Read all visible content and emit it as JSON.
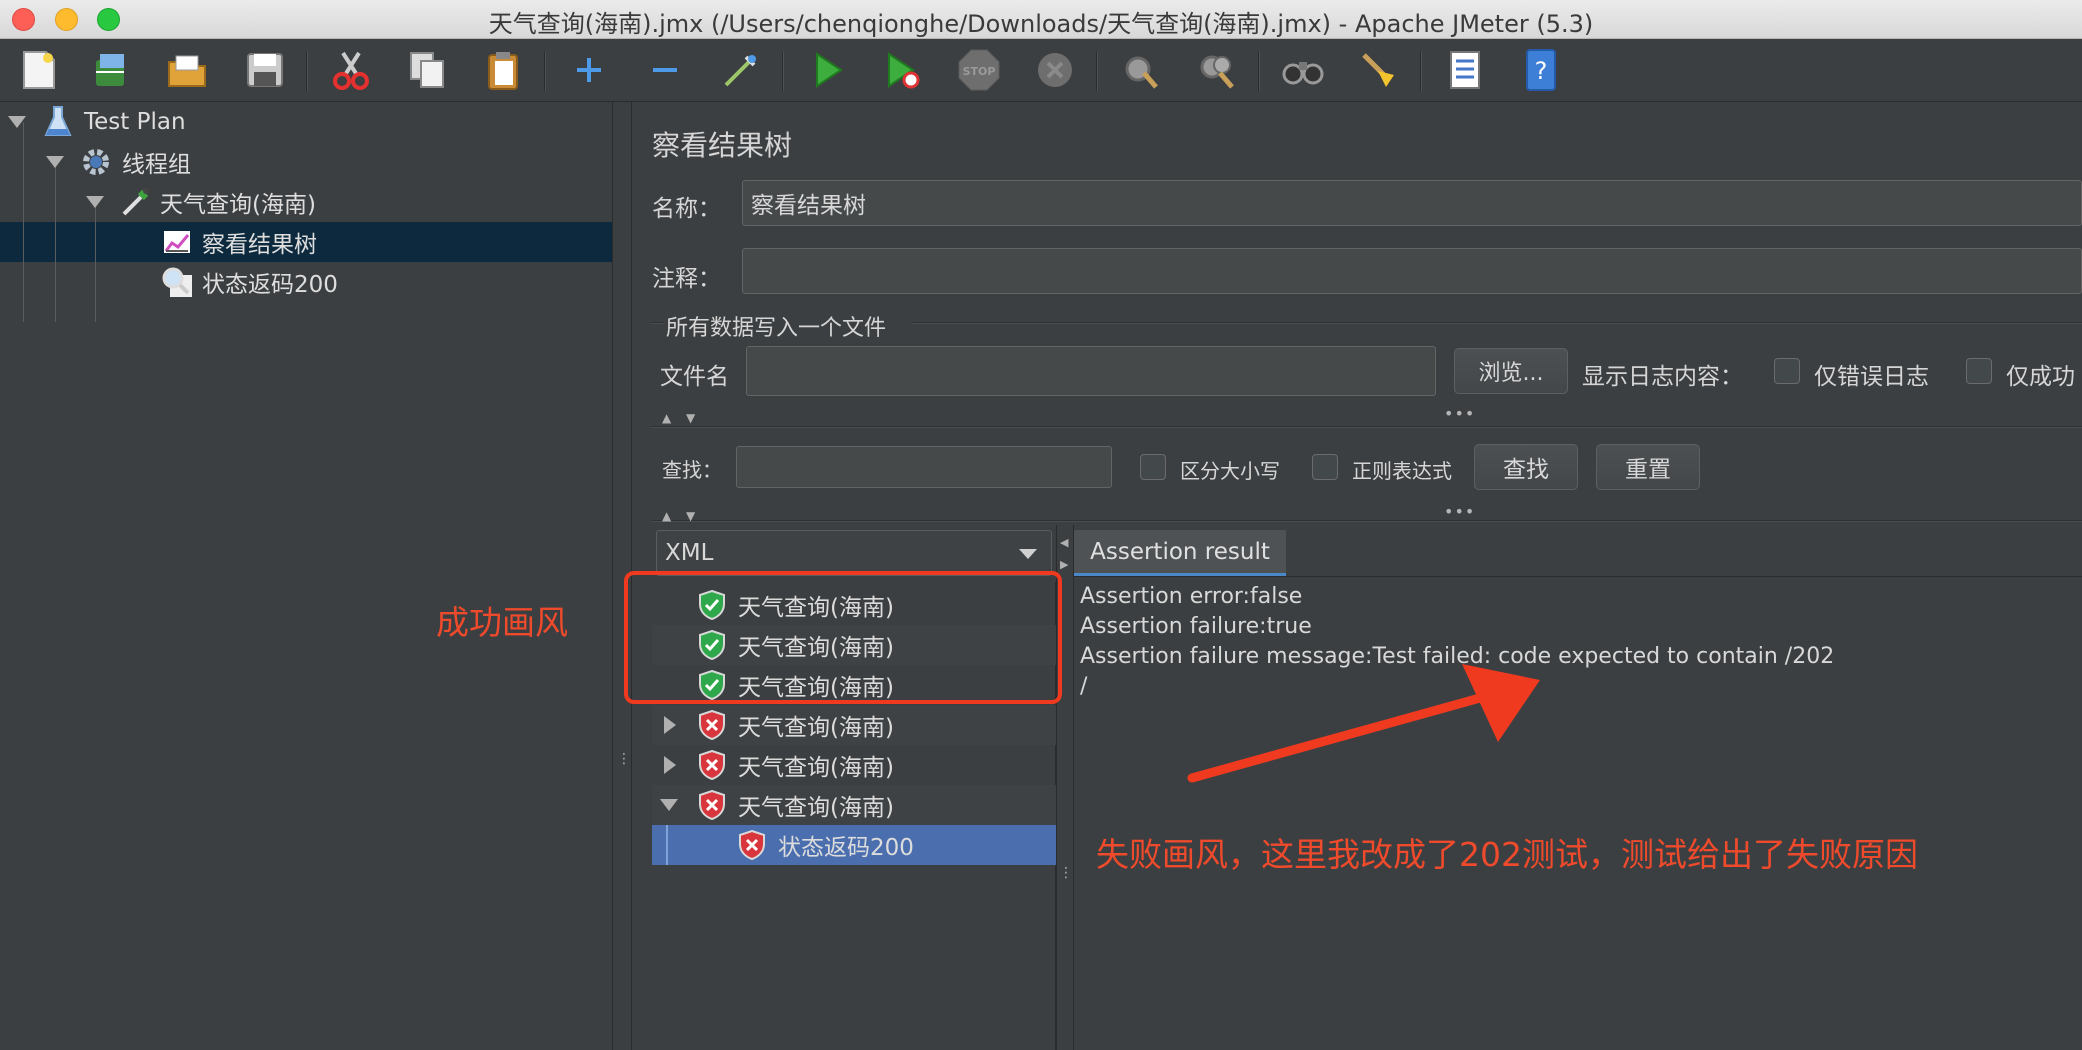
{
  "window": {
    "title": "天气查询(海南).jmx (/Users/chenqionghe/Downloads/天气查询(海南).jmx) - Apache JMeter (5.3)"
  },
  "toolbar": {
    "icons": [
      "new-file-icon",
      "templates-icon",
      "open-icon",
      "save-icon",
      "cut-icon",
      "copy-icon",
      "paste-icon",
      "expand-icon",
      "collapse-icon",
      "toggle-icon",
      "start-icon",
      "start-no-pause-icon",
      "stop-icon",
      "shutdown-icon",
      "clear-icon",
      "clear-all-icon",
      "search-icon",
      "reset-search-icon",
      "function-helper-icon",
      "help-icon"
    ]
  },
  "tree": {
    "items": [
      {
        "label": "Test Plan",
        "icon": "flask-icon"
      },
      {
        "label": "线程组",
        "icon": "gear-icon"
      },
      {
        "label": "天气查询(海南)",
        "icon": "pipette-icon"
      },
      {
        "label": "察看结果树",
        "icon": "chart-icon",
        "selected": true
      },
      {
        "label": "状态返码200",
        "icon": "magnifier-icon"
      }
    ]
  },
  "panel": {
    "title": "察看结果树",
    "name_label": "名称：",
    "name_value": "察看结果树",
    "comment_label": "注释：",
    "comment_value": "",
    "file_section_title": "所有数据写入一个文件",
    "filename_label": "文件名",
    "filename_value": "",
    "browse_button": "浏览...",
    "log_content_label": "显示日志内容：",
    "errors_only_label": "仅错误日志",
    "success_only_label": "仅成功",
    "search_label": "查找：",
    "search_value": "",
    "case_sensitive_label": "区分大小写",
    "regex_label": "正则表达式",
    "find_button": "查找",
    "reset_button": "重置",
    "renderer_selected": "XML"
  },
  "results": [
    {
      "label": "天气查询(海南)",
      "status": "success"
    },
    {
      "label": "天气查询(海南)",
      "status": "success"
    },
    {
      "label": "天气查询(海南)",
      "status": "success"
    },
    {
      "label": "天气查询(海南)",
      "status": "failure",
      "expander": "collapsed"
    },
    {
      "label": "天气查询(海南)",
      "status": "failure",
      "expander": "collapsed"
    },
    {
      "label": "天气查询(海南)",
      "status": "failure",
      "expander": "expanded"
    },
    {
      "label": "状态返码200",
      "status": "failure",
      "child": true,
      "selected": true
    }
  ],
  "result_tab": {
    "label": "Assertion result",
    "lines": [
      "Assertion error:false",
      "Assertion failure:true",
      "Assertion failure message:Test failed: code expected to contain /202",
      "/"
    ]
  },
  "annotations": {
    "success_note": "成功画风",
    "failure_note": "失败画风，这里我改成了202测试，测试给出了失败原因",
    "color": "#ee4a2b"
  }
}
